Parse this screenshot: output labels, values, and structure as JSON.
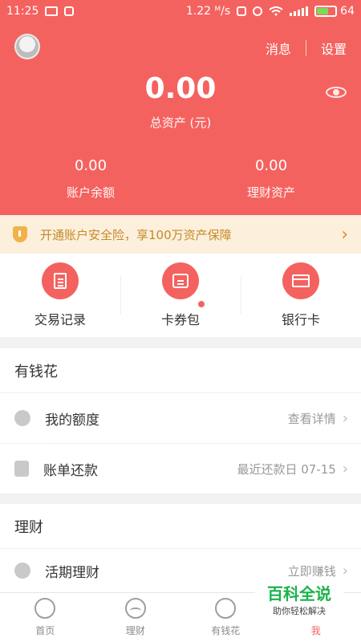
{
  "status_bar": {
    "time": "11:25",
    "speed": "1.22 ᴹ/s",
    "battery": "64",
    "battery_level": 0.64
  },
  "header": {
    "links": {
      "messages": "消息",
      "settings": "设置"
    },
    "total_amount": "0.00",
    "total_label": "总资产 (元)",
    "stats": [
      {
        "value": "0.00",
        "label": "账户余额"
      },
      {
        "value": "0.00",
        "label": "理财资产"
      }
    ],
    "icons": {
      "avatar": "avatar-icon",
      "eye": "eye-icon"
    }
  },
  "banner": {
    "text": "开通账户安全险，享100万资产保障",
    "icon": "shield-icon"
  },
  "actions": [
    {
      "label": "交易记录",
      "icon": "transactions-icon"
    },
    {
      "label": "卡券包",
      "icon": "ticket-icon",
      "dot": true
    },
    {
      "label": "银行卡",
      "icon": "bank-card-icon"
    }
  ],
  "sections": [
    {
      "title": "有钱花",
      "rows": [
        {
          "label": "我的额度",
          "right_text": "查看详情",
          "icon": "pie-icon"
        },
        {
          "label": "账单还款",
          "right_text": "最近还款日 07-15",
          "icon": "bill-icon"
        }
      ]
    },
    {
      "title": "理财",
      "rows": [
        {
          "label": "活期理财",
          "right_text": "立即赚钱",
          "icon": "yen-icon"
        }
      ]
    }
  ],
  "bottom_nav": [
    {
      "label": "首页",
      "icon": "home-icon"
    },
    {
      "label": "理财",
      "icon": "finance-icon"
    },
    {
      "label": "有钱花",
      "icon": "credit-icon"
    },
    {
      "label": "我",
      "icon": "me-icon",
      "active": true
    }
  ],
  "watermark": {
    "title": "百科全说",
    "subtitle": "助你轻松解决"
  },
  "colors": {
    "brand": "#f4625f",
    "banner_bg": "#fcf0dd",
    "banner_text": "#c58a27"
  }
}
